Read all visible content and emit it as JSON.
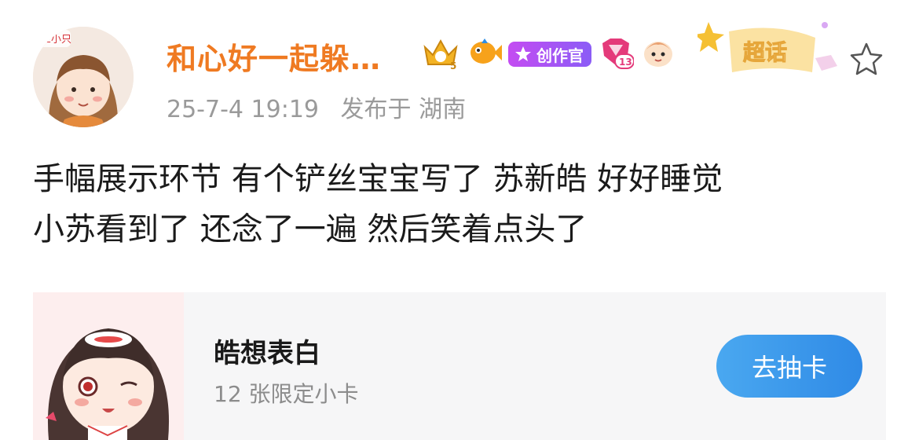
{
  "post": {
    "author_name": "和心好一起躲…",
    "creator_badge_label": "创作官",
    "vip_level": "5",
    "fan_level": "13",
    "timestamp": "25-7-4 19:19",
    "location": "发布于 湖南",
    "supertopic_label": "超话",
    "content_lines": [
      "手幅展示环节 有个铲丝宝宝写了 苏新皓 好好睡觉",
      "小苏看到了 还念了一遍 然后笑着点头了"
    ]
  },
  "card": {
    "title": "皓想表白",
    "subtitle": "12 张限定小卡",
    "button_label": "去抽卡"
  },
  "colors": {
    "author_name": "#ef7a22",
    "meta_text": "#9a9a9a",
    "button": "#3a96ea",
    "card_bg": "#f6f6f7"
  },
  "icons": [
    "crown-level-icon",
    "fish-icon",
    "creator-badge-icon",
    "fan-level-icon",
    "mascot-icon",
    "supertopic-icon",
    "favorite-star-icon"
  ]
}
